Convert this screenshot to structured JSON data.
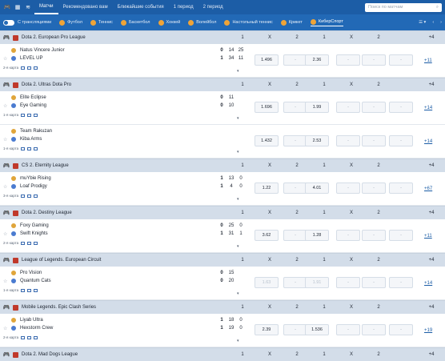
{
  "topbar": {
    "tabs": [
      "Матчи",
      "Рекомендовано вам",
      "Ближайшие события",
      "1 период",
      "2 период"
    ],
    "active": 0,
    "search_placeholder": "Поиск по матчам"
  },
  "filter": {
    "stream_label": "С трансляциями",
    "sports": [
      "Футбол",
      "Теннис",
      "Баскетбол",
      "Хоккей",
      "Волейбол",
      "Настольный теннис",
      "Крикет",
      "КиберСпорт"
    ],
    "active": "КиберСпорт"
  },
  "columns": [
    "1",
    "X",
    "2",
    "1",
    "X",
    "2",
    "+4"
  ],
  "leagues": [
    {
      "name": "Dota 2. European Pro League",
      "events": [
        {
          "t1": "Natus Vincere Junior",
          "t2": "LEVEL UP",
          "s1": [
            "0",
            "14",
            "25"
          ],
          "s2": [
            "1",
            "34",
            "11"
          ],
          "label": "2-я карта",
          "odds": [
            "1.496",
            "-",
            "2.36",
            "-",
            "-",
            "-"
          ],
          "more": "+11"
        }
      ]
    },
    {
      "name": "Dota 2. Ultras Dota Pro",
      "events": [
        {
          "t1": "Elite Eclipse",
          "t2": "Eye Gaming",
          "s1": [
            "0",
            "11"
          ],
          "s2": [
            "0",
            "10"
          ],
          "label": "1-я карта",
          "odds": [
            "1.696",
            "-",
            "1.99",
            "-",
            "-",
            "-"
          ],
          "more": "+14"
        },
        {
          "t1": "Team Rakuzan",
          "t2": "Kiba Arms",
          "s1": [],
          "s2": [],
          "label": "1-я карта",
          "odds": [
            "1.432",
            "-",
            "2.53",
            "-",
            "-",
            "-"
          ],
          "more": "+14"
        }
      ]
    },
    {
      "name": "CS 2. Eternity League",
      "events": [
        {
          "t1": "muYbie Rising",
          "t2": "Loaf Prodigy",
          "s1": [
            "1",
            "13",
            "0"
          ],
          "s2": [
            "1",
            "4",
            "0"
          ],
          "label": "3-я карта",
          "odds": [
            "1.22",
            "-",
            "4.01",
            "-",
            "-",
            "-"
          ],
          "more": "+67"
        }
      ]
    },
    {
      "name": "Dota 2. Destiny League",
      "events": [
        {
          "t1": "Foxy Gaming",
          "t2": "Swift Knights",
          "s1": [
            "0",
            "25",
            "0"
          ],
          "s2": [
            "1",
            "31",
            "1"
          ],
          "label": "2-я карта",
          "odds": [
            "3.62",
            "-",
            "1.28",
            "-",
            "-",
            "-"
          ],
          "more": "+11"
        }
      ]
    },
    {
      "name": "League of Legends. European Circuit",
      "events": [
        {
          "t1": "Pro Vision",
          "t2": "Quantum Cats",
          "s1": [
            "0",
            "15"
          ],
          "s2": [
            "0",
            "20"
          ],
          "label": "1-я карта",
          "odds": [
            "1.63",
            "-",
            "1.91",
            "-",
            "-",
            "-"
          ],
          "more": "+14",
          "locked": true
        }
      ]
    },
    {
      "name": "Mobile Legends. Epic Clash Series",
      "events": [
        {
          "t1": "Liyab Ultra",
          "t2": "Hexstorm Crew",
          "s1": [
            "1",
            "18",
            "0"
          ],
          "s2": [
            "1",
            "19",
            "0"
          ],
          "label": "2-я карта",
          "odds": [
            "2.39",
            "-",
            "1.536",
            "-",
            "-",
            "-"
          ],
          "more": "+19"
        }
      ]
    },
    {
      "name": "Dota 2. Mad Dogs League",
      "events": []
    }
  ],
  "colors": {
    "primary": "#1c5da6",
    "header_row": "#d3dde9"
  }
}
